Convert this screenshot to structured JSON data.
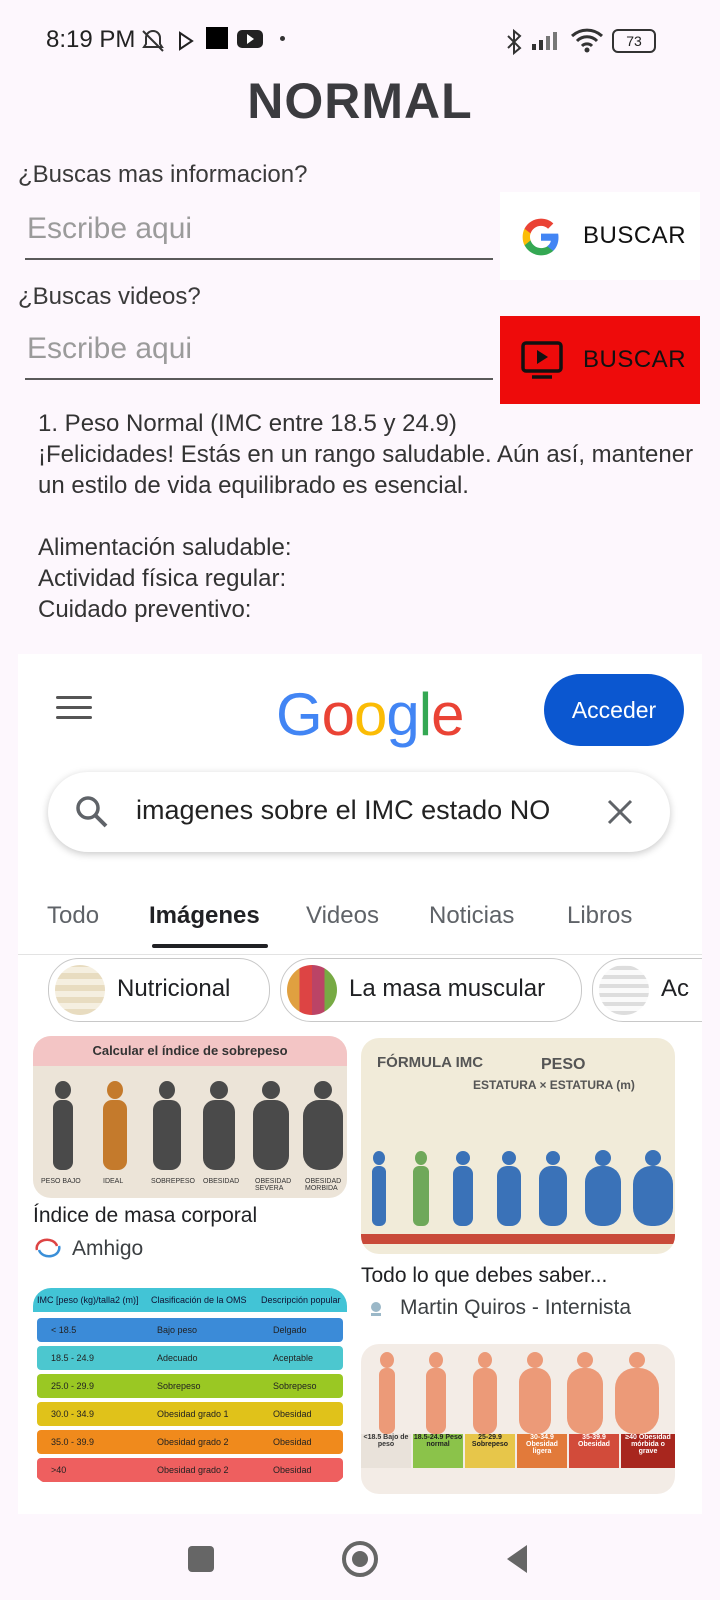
{
  "status_bar": {
    "time": "8:19 PM",
    "battery": "73"
  },
  "header": {
    "title": "NORMAL"
  },
  "search_info": {
    "label": "¿Buscas mas informacion?",
    "placeholder": "Escribe aqui",
    "button_label": "BUSCAR"
  },
  "search_videos": {
    "label": "¿Buscas videos?",
    "placeholder": "Escribe aqui",
    "button_label": "BUSCAR"
  },
  "info_text": "1. Peso Normal (IMC entre 18.5 y 24.9)\n¡Felicidades! Estás en un rango saludable. Aún así, mantener un estilo de vida equilibrado es esencial.\n\nAlimentación saludable:\nActividad física regular:\nCuidado preventivo:",
  "webview": {
    "logo": "Google",
    "sign_in": "Acceder",
    "query": "imagenes sobre el IMC estado NO",
    "tabs": [
      "Todo",
      "Imágenes",
      "Videos",
      "Noticias",
      "Libros"
    ],
    "active_tab": "Imágenes",
    "chips": [
      "Nutricional",
      "La masa muscular",
      "Ac"
    ],
    "results": [
      {
        "caption": "Índice de masa corporal",
        "source": "Amhigo",
        "image_title": "Calcular el índice de sobrepeso",
        "labels": [
          "PESO BAJO",
          "IDEAL",
          "SOBREPESO",
          "OBESIDAD",
          "OBESIDAD SEVERA",
          "OBESIDAD MORBIDA"
        ]
      },
      {
        "caption": "Todo lo que debes saber...",
        "source": "Martin Quiros - Internista",
        "image_title_a": "FÓRMULA IMC",
        "image_title_b": "PESO",
        "image_title_c": "ESTATURA × ESTATURA (m)"
      },
      {
        "table_header": [
          "IMC [peso (kg)/talla2 (m)]",
          "Clasificación de la OMS",
          "Descripción popular"
        ],
        "rows": [
          [
            "< 18.5",
            "Bajo peso",
            "Delgado"
          ],
          [
            "18.5 - 24.9",
            "Adecuado",
            "Aceptable"
          ],
          [
            "25.0 - 29.9",
            "Sobrepeso",
            "Sobrepeso"
          ],
          [
            "30.0 - 34.9",
            "Obesidad grado 1",
            "Obesidad"
          ],
          [
            "35.0 - 39.9",
            "Obesidad grado 2",
            "Obesidad"
          ],
          [
            ">40",
            "Obesidad grado 2",
            "Obesidad"
          ]
        ],
        "row_colors": [
          "#3b8bd8",
          "#4cc7cf",
          "#9ac823",
          "#e0c21a",
          "#f08a1c",
          "#ee5f5f"
        ]
      },
      {
        "labels": [
          "<18.5 Bajo de peso",
          "18.5-24.9 Peso normal",
          "25-29.9 Sobrepeso",
          "30-34.9 Obesidad ligera",
          "35-39.9 Obesidad",
          "≥40 Obesidad mórbida o grave"
        ]
      }
    ]
  },
  "colors": {
    "youtube_red": "#ee0b0b",
    "google_blue": "#0b57d0"
  }
}
